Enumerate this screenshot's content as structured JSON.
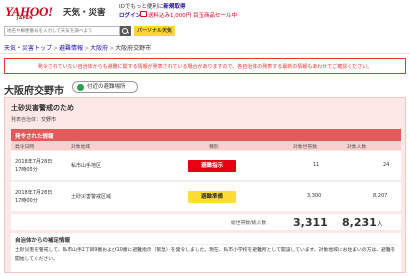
{
  "header": {
    "logo_text": "YAHOO!",
    "logo_sub": "JAPAN",
    "site_name": "天気・災害",
    "promo_prefix": "IDでもっと便利に",
    "promo_link": "新規取得",
    "login": "ログイン",
    "promo_shipping": "送料込み1,000円 目玉商品セール中"
  },
  "search": {
    "placeholder": "地名や郵便番号を入力して天気を調べよう",
    "weather_button": "パーソナル天気"
  },
  "breadcrumb": {
    "items": [
      "天気・災害トップ",
      "避難情報",
      "大阪府"
    ],
    "current": "大阪府交野市"
  },
  "alert": {
    "text": "発令されていない自治体からも避難に関する情報が発表されている場合がありますので、各自治体の発表する最新の情報もあわせてご確認ください。"
  },
  "page": {
    "title": "大阪府交野市",
    "shelter_button": "付近の避難場所"
  },
  "section": {
    "title": "土砂災害警戒のため",
    "issuer_label": "発表自治体：",
    "issuer_value": "交野市",
    "info_header": "発令された情報"
  },
  "table": {
    "headers": [
      "発令日時",
      "対象地域",
      "種別",
      "対象世帯数",
      "対象人数"
    ],
    "rows": [
      {
        "date": "2018年7月28日",
        "time": "17時05分",
        "area": "私市山手地区",
        "type": "避難指示",
        "type_color": "red",
        "households": "11",
        "persons": "24"
      },
      {
        "date": "2018年7月28日",
        "time": "17時00分",
        "area": "土砂災害警戒区域",
        "type": "避難準備",
        "type_color": "yellow",
        "households": "3,300",
        "persons": "8,207"
      }
    ],
    "totals_label": "総世帯数/総人数",
    "total_households": "3,311",
    "total_persons": "8,231",
    "persons_unit": "人"
  },
  "supplement": {
    "title": "自治体からの補足情報",
    "text": "土砂災害を警戒して、私市山手2丁目9番および10番に避難指示（緊急）を発令しました。現在、私市小学校を避難所として開設しています。対象地域にお住まいの方は、避難を開始してください。"
  },
  "colors": {
    "brand_red": "#d0021b",
    "alert_red": "#e60012",
    "warning_yellow": "#ffdd33",
    "section_pink": "#fde8e8",
    "header_bar": "#e25a5a"
  }
}
